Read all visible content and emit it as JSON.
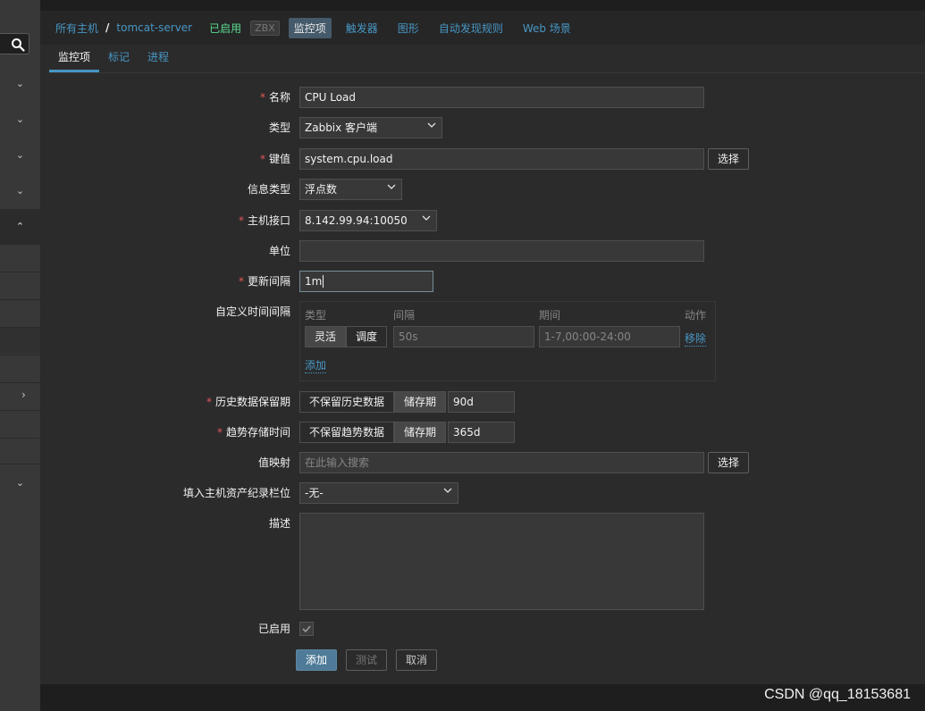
{
  "breadcrumb": {
    "all_hosts": "所有主机",
    "separator": "/",
    "host": "tomcat-server",
    "status": "已启用",
    "zbx": "ZBX"
  },
  "header_tabs": [
    "监控项",
    "触发器",
    "图形",
    "自动发现规则",
    "Web 场景"
  ],
  "content_tabs": [
    "监控项",
    "标记",
    "进程"
  ],
  "form": {
    "name": {
      "label": "名称",
      "value": "CPU Load"
    },
    "type": {
      "label": "类型",
      "value": "Zabbix 客户端"
    },
    "key": {
      "label": "键值",
      "value": "system.cpu.load",
      "button": "选择"
    },
    "info_type": {
      "label": "信息类型",
      "value": "浮点数"
    },
    "interface": {
      "label": "主机接口",
      "value": "8.142.99.94:10050"
    },
    "units": {
      "label": "单位",
      "value": ""
    },
    "interval": {
      "label": "更新间隔",
      "value": "1m"
    },
    "custom_intervals": {
      "label": "自定义时间间隔",
      "headers": {
        "type": "类型",
        "interval": "间隔",
        "period": "期间",
        "action": "动作"
      },
      "seg_flexible": "灵活",
      "seg_scheduling": "调度",
      "interval_placeholder": "50s",
      "period_placeholder": "1-7,00:00-24:00",
      "remove": "移除",
      "add": "添加"
    },
    "history": {
      "label": "历史数据保留期",
      "opt_none": "不保留历史数据",
      "opt_storage": "储存期",
      "value": "90d"
    },
    "trends": {
      "label": "趋势存储时间",
      "opt_none": "不保留趋势数据",
      "opt_storage": "储存期",
      "value": "365d"
    },
    "valuemap": {
      "label": "值映射",
      "placeholder": "在此输入搜索",
      "button": "选择"
    },
    "inventory": {
      "label": "填入主机资产纪录栏位",
      "value": "-无-"
    },
    "description": {
      "label": "描述",
      "value": ""
    },
    "enabled": {
      "label": "已启用",
      "checked": true
    }
  },
  "actions": {
    "add": "添加",
    "test": "测试",
    "cancel": "取消"
  },
  "watermark": "CSDN @qq_18153681",
  "colors": {
    "link": "#4796c4",
    "required": "#e45959",
    "enabled": "#59db8f"
  }
}
